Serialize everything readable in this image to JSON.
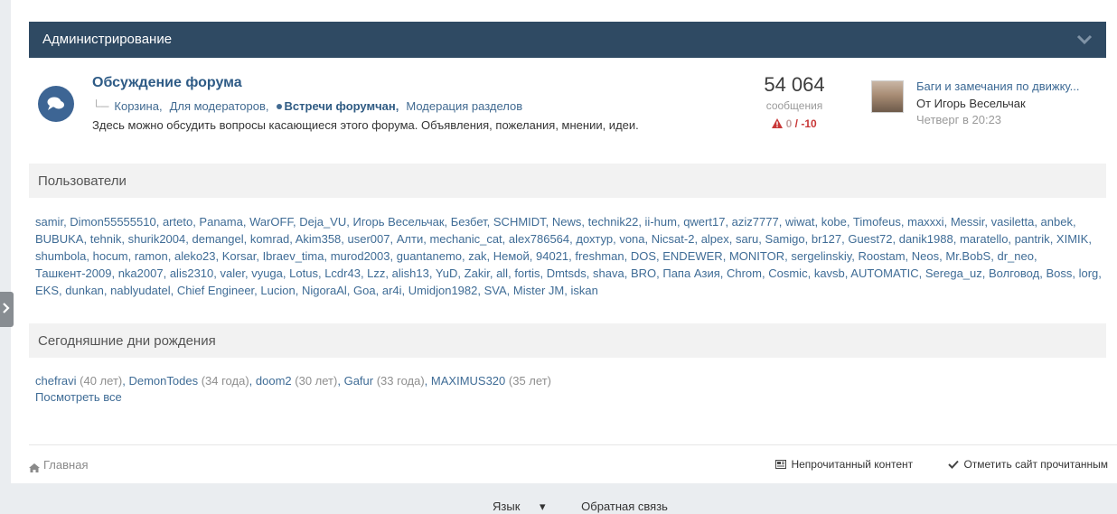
{
  "category": {
    "title": "Администрирование"
  },
  "forum": {
    "title": "Обсуждение форума",
    "subforums": [
      "Корзина",
      "Для модераторов",
      "Встречи форумчан",
      "Модерация разделов"
    ],
    "description": "Здесь можно обсудить вопросы касающиеся этого форума. Объявления, пожелания, мнении, идеи.",
    "posts_count": "54 064",
    "posts_label": "сообщения",
    "rep_zero": "0",
    "rep_slash": "/",
    "rep_neg": "-10",
    "last_post": {
      "title": "Баги и замечания по движку...",
      "author": "От Игорь Весельчак",
      "time": "Четверг в 20:23"
    }
  },
  "users_section": {
    "title": "Пользователи",
    "names": [
      "samir",
      "Dimon55555510",
      "arteto",
      "Panama",
      "WarOFF",
      "Deja_VU",
      "Игорь Весельчак",
      "Безбет",
      "SCHMIDT",
      "News",
      "technik22",
      "ii-hum",
      "qwert17",
      "aziz7777",
      "wiwat",
      "kobe",
      "Timofeus",
      "maxxxi",
      "Messir",
      "vasiletta",
      "anbek",
      "BUBUKA",
      "tehnik",
      "shurik2004",
      "demangel",
      "komrad",
      "Akim358",
      "user007",
      "Алти",
      "mechanic_cat",
      "alex786564",
      "дохтур",
      "vona",
      "Nicsat-2",
      "alpex",
      "saru",
      "Samigo",
      "br127",
      "Guest72",
      "danik1988",
      "maratello",
      "pantrik",
      "XIMIK",
      "shumbola",
      "hocum",
      "ramon",
      "aleko23",
      "Korsar",
      "Ibraev_tima",
      "murod2003",
      "guantanemo",
      "zak",
      "Немой",
      "94021",
      "freshman",
      "DOS",
      "ENDEWER",
      "MONITOR",
      "sergelinskiy",
      "Roostam",
      "Neos",
      "Mr.BobS",
      "dr_neo",
      "Ташкент-2009",
      "nka2007",
      "alis2310",
      "valer",
      "vyuga",
      "Lotus",
      "Lcdr43",
      "Lzz",
      "alish13",
      "YuD",
      "Zakir",
      "all",
      "fortis",
      "Dmtsds",
      "shava",
      "BRO",
      "Папа Азия",
      "Chrom",
      "Cosmic",
      "kavsb",
      "AUTOMATIC",
      "Serega_uz",
      "Волговод",
      "Boss",
      "lorg",
      "EKS",
      "dunkan",
      "nablyudatel",
      "Chief Engineer",
      "Lucion",
      "NigoraAl",
      "Goa",
      "ar4i",
      "Umidjon1982",
      "SVA",
      "Mister JM",
      "iskan"
    ]
  },
  "birthdays_section": {
    "title": "Сегодняшние дни рождения",
    "people": [
      {
        "name": "chefravi",
        "age": "(40 лет)"
      },
      {
        "name": "DemonTodes",
        "age": "(34 года)"
      },
      {
        "name": "doom2",
        "age": "(30 лет)"
      },
      {
        "name": "Gafur",
        "age": "(33 года)"
      },
      {
        "name": "MAXIMUS320",
        "age": "(35 лет)"
      }
    ],
    "see_all": "Посмотреть все"
  },
  "footer": {
    "home": "Главная",
    "unread": "Непрочитанный контент",
    "mark_read": "Отметить сайт прочитанным",
    "language": "Язык",
    "feedback": "Обратная связь"
  },
  "colors": {
    "header_bg": "#2f4a63",
    "link": "#3f6c96",
    "accent": "#3d6594",
    "negative": "#c83737"
  }
}
